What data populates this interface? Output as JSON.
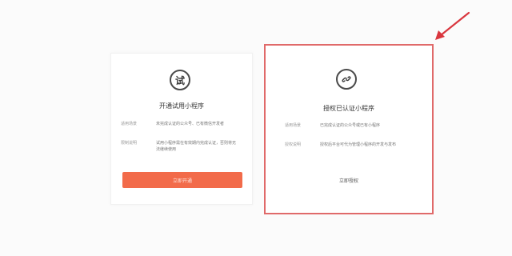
{
  "cards": [
    {
      "icon": "trial-icon",
      "icon_text": "试",
      "title": "开通试用小程序",
      "rows": [
        {
          "key": "适用场景",
          "value": "未完成认证的公众号、已有微信开发者"
        },
        {
          "key": "限制说明",
          "value": "试用小程序需在有效期内完成认证，否则将无法继续使用"
        }
      ],
      "button_label": "立即开通"
    },
    {
      "icon": "link-icon",
      "title": "授权已认证小程序",
      "rows": [
        {
          "key": "适用场景",
          "value": "已完成认证的公众号或已有小程序"
        },
        {
          "key": "授权说明",
          "value": "授权后平台可代为管理小程序的开发与发布"
        }
      ],
      "link_label": "立即授权"
    }
  ],
  "colors": {
    "highlight_border": "#e06a6a",
    "button_bg": "#f26b4a",
    "annotation_arrow": "#d9363e"
  }
}
